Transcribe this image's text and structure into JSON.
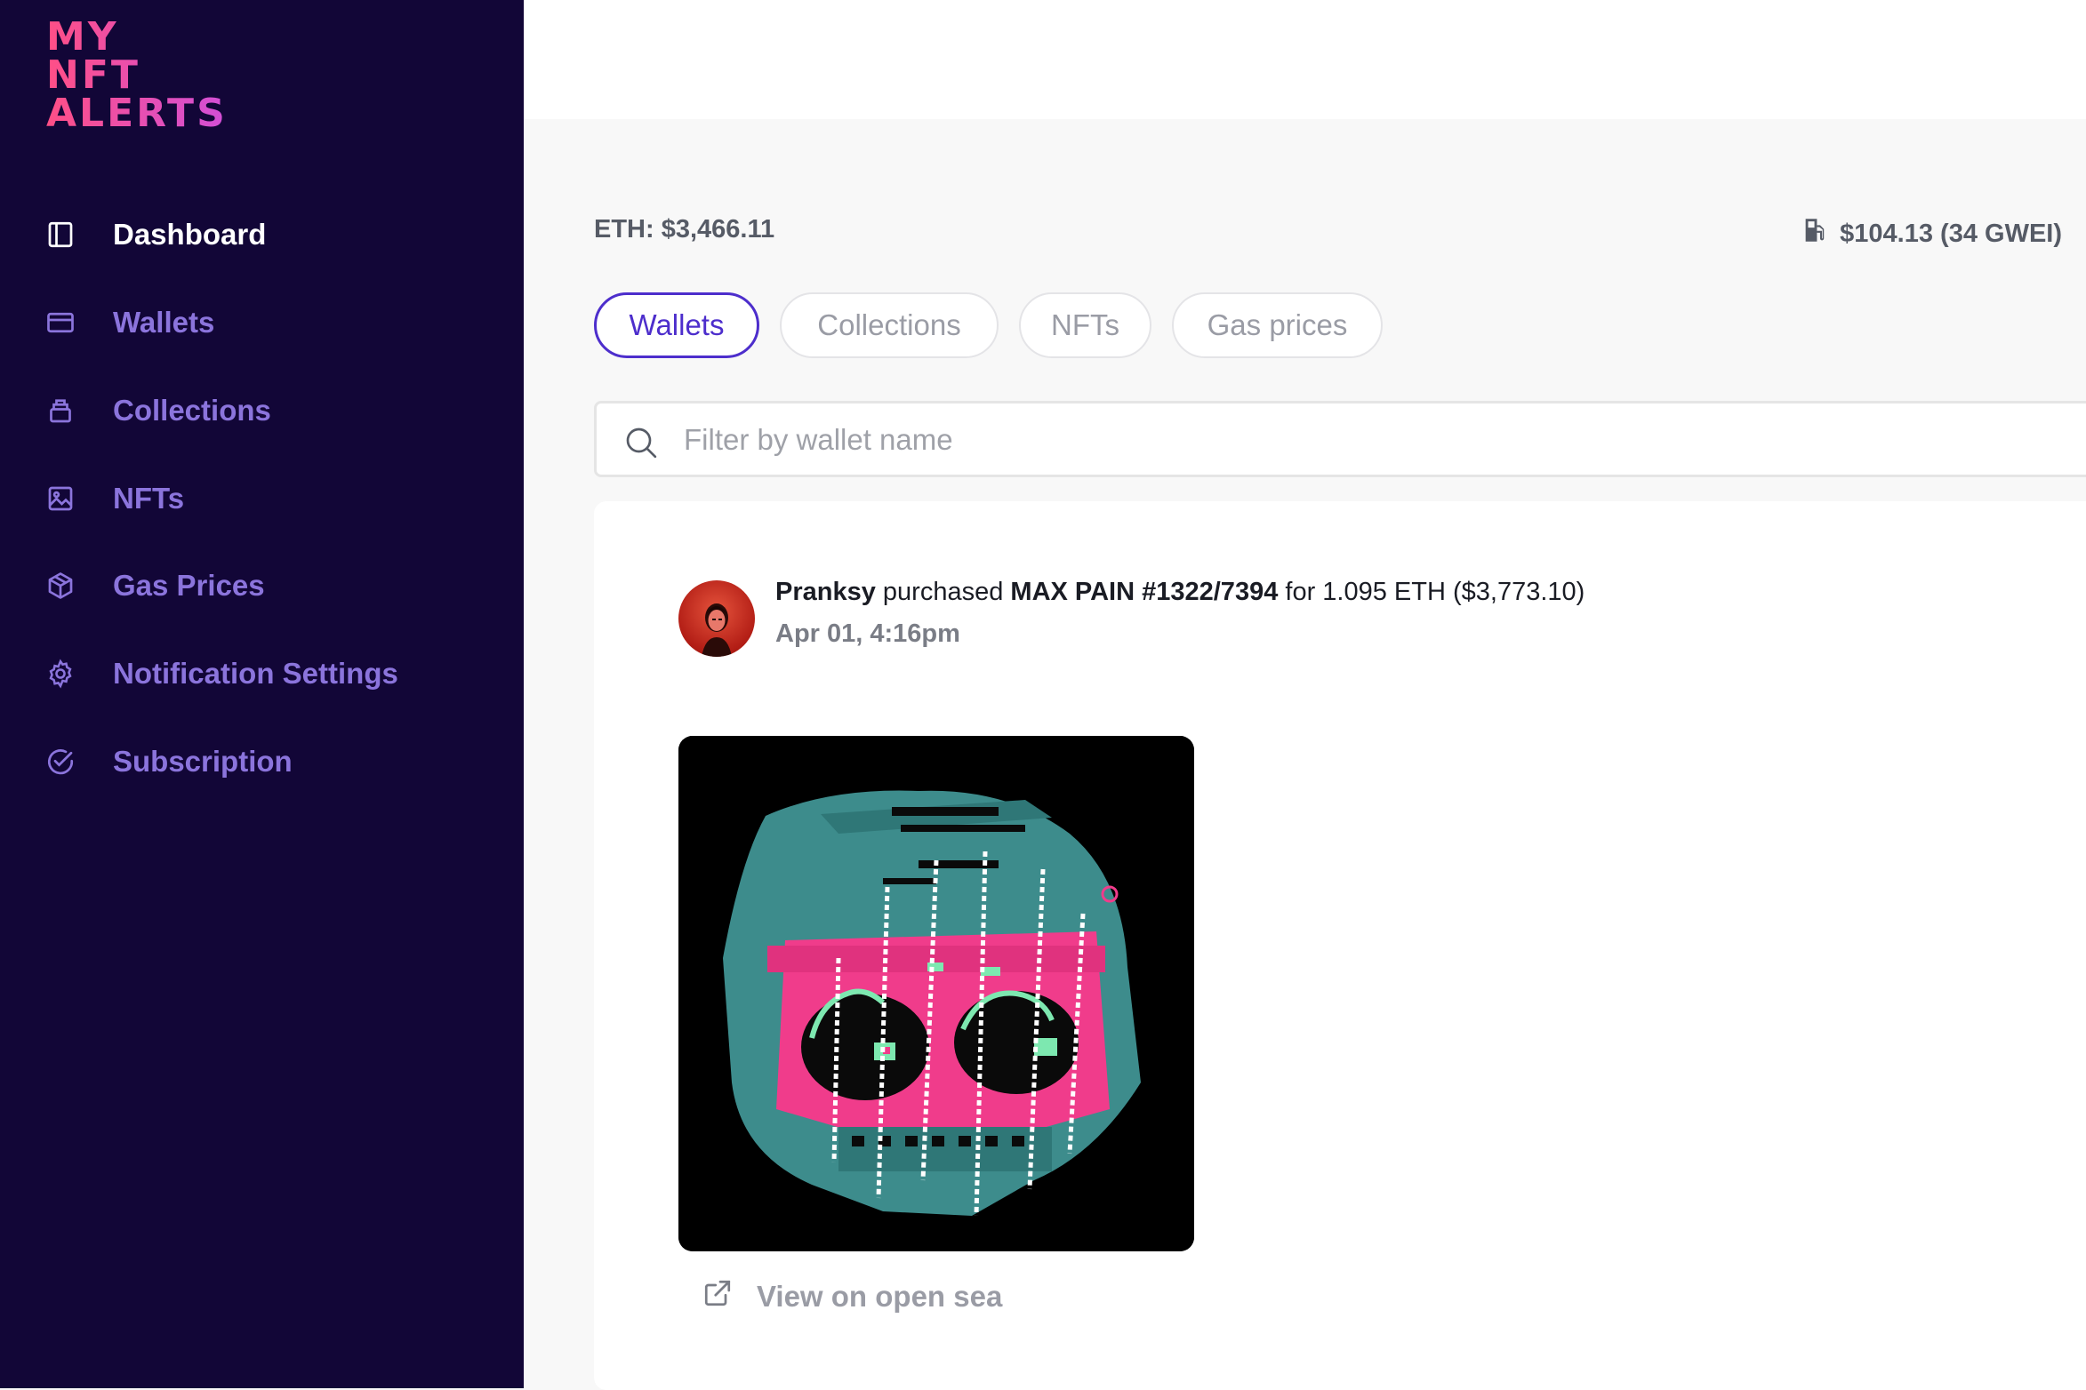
{
  "brand": {
    "line1": "MY NFT",
    "line2": "ALERTS"
  },
  "sidebar": {
    "items": [
      {
        "label": "Dashboard",
        "icon": "sidebar-panel-icon",
        "active": true
      },
      {
        "label": "Wallets",
        "icon": "credit-card-icon"
      },
      {
        "label": "Collections",
        "icon": "archive-icon"
      },
      {
        "label": "NFTs",
        "icon": "image-icon"
      },
      {
        "label": "Gas Prices",
        "icon": "cube-icon"
      },
      {
        "label": "Notification Settings",
        "icon": "gear-icon"
      },
      {
        "label": "Subscription",
        "icon": "check-circle-icon"
      }
    ]
  },
  "header": {
    "eth_price": "ETH: $3,466.11",
    "gas_price": "$104.13 (34 GWEI)",
    "gas_icon": "fuel-pump-icon"
  },
  "tabs": [
    {
      "label": "Wallets",
      "active": true
    },
    {
      "label": "Collections"
    },
    {
      "label": "NFTs"
    },
    {
      "label": "Gas prices"
    }
  ],
  "search": {
    "placeholder": "Filter by wallet name",
    "value": ""
  },
  "activity": {
    "wallet": "Pranksy",
    "action": "purchased",
    "nft": "MAX PAIN #1322/7394",
    "price_text": "for 1.095 ETH ($3,773.10)",
    "time": "Apr 01, 4:16pm",
    "link_label": "View on open sea",
    "link_icon": "external-link-icon"
  },
  "colors": {
    "sidebar_bg": "#120637",
    "nav_text": "#8b74dc",
    "accent": "#4d2ecc",
    "brand_pink": "#ff4f86"
  }
}
